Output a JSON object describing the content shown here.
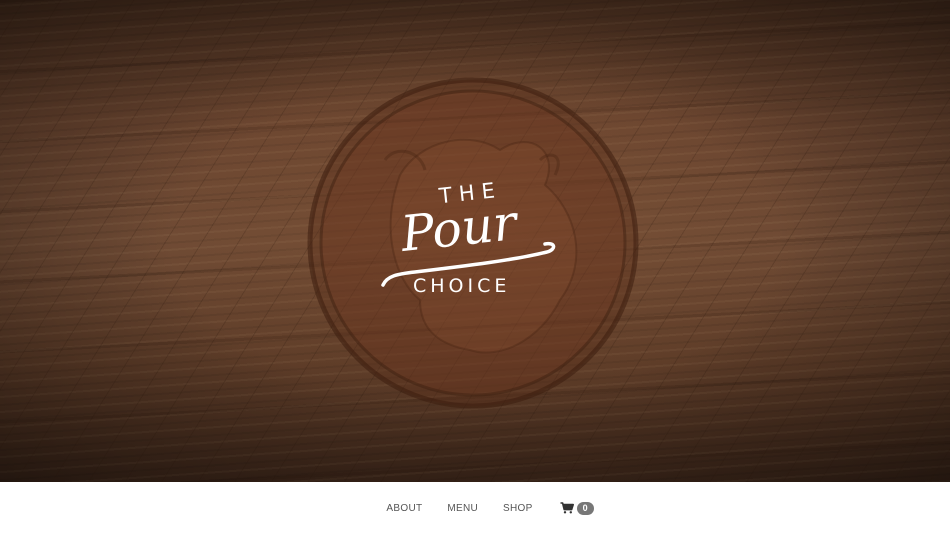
{
  "hero": {
    "logo": {
      "line1": "THE",
      "line2": "Pour",
      "line3": "CHOICE"
    }
  },
  "nav": {
    "items": [
      {
        "label": "ABOUT"
      },
      {
        "label": "MENU"
      },
      {
        "label": "SHOP"
      }
    ],
    "cart": {
      "icon": "shopping-cart-icon",
      "count": "0"
    }
  },
  "colors": {
    "wood": "#6e4a34",
    "logo": "#ffffff",
    "nav_text": "#555555",
    "badge": "#777777"
  }
}
